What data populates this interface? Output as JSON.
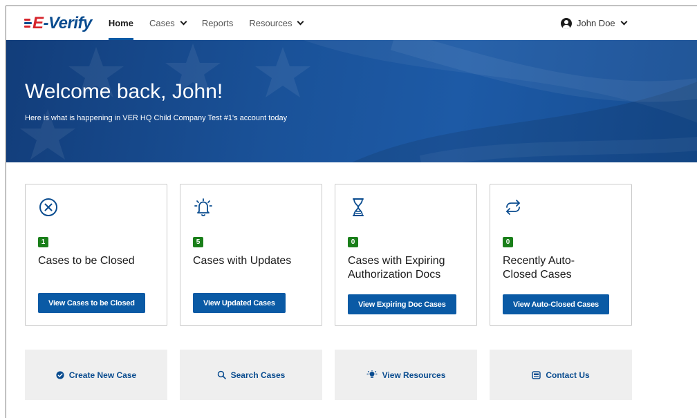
{
  "nav": {
    "logo_e": "E",
    "logo_rest": "-Verify",
    "items": [
      {
        "label": "Home"
      },
      {
        "label": "Cases"
      },
      {
        "label": "Reports"
      },
      {
        "label": "Resources"
      }
    ],
    "user": "John Doe",
    "flag_colors": [
      "#d6242b",
      "#0a4c8f",
      "#d6242b"
    ]
  },
  "hero": {
    "title": "Welcome back, John!",
    "subtitle": "Here is what is happening in VER HQ Child Company Test #1's account today"
  },
  "cards": [
    {
      "icon": "close-circle-icon",
      "count": "1",
      "title": "Cases to be Closed",
      "button": "View Cases to be Closed"
    },
    {
      "icon": "bell-icon",
      "count": "5",
      "title": "Cases with Updates",
      "button": "View Updated Cases"
    },
    {
      "icon": "hourglass-icon",
      "count": "0",
      "title": "Cases with Expiring Authorization Docs",
      "button": "View Expiring Doc Cases"
    },
    {
      "icon": "repeat-icon",
      "count": "0",
      "title": "Recently Auto-Closed Cases",
      "button": "View Auto-Closed Cases"
    }
  ],
  "tiles": [
    {
      "icon": "check-badge-icon",
      "label": "Create New Case"
    },
    {
      "icon": "search-icon",
      "label": "Search Cases"
    },
    {
      "icon": "lightbulb-icon",
      "label": "View Resources"
    },
    {
      "icon": "contact-icon",
      "label": "Contact Us"
    }
  ],
  "colors": {
    "primary": "#0a5aa5",
    "badge": "#1a7f1a",
    "hero": "#1a5299",
    "tile_bg": "#efefef"
  }
}
